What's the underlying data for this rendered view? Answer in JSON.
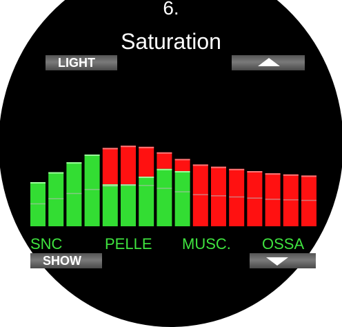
{
  "header": {
    "number": "6.",
    "title": "Saturation"
  },
  "softkeys": {
    "top_left": "LIGHT",
    "top_right_icon": "arrow-up-icon",
    "bottom_left": "SHOW",
    "bottom_right_icon": "arrow-down-icon"
  },
  "categories": {
    "snc": "SNC",
    "pelle": "PELLE",
    "musc": "MUSC.",
    "ossa": "OSSA"
  },
  "colors": {
    "green": "#33dd33",
    "red": "#ff1111",
    "background": "#000000",
    "text": "#ffffff",
    "label": "#3fe33f"
  },
  "chart_data": {
    "type": "bar",
    "description_units": "relative tissue saturation level per compartment (0-1)",
    "compartments": [
      {
        "total": 0.4,
        "green": 0.4
      },
      {
        "total": 0.49,
        "green": 0.49
      },
      {
        "total": 0.58,
        "green": 0.58
      },
      {
        "total": 0.65,
        "green": 0.65
      },
      {
        "total": 0.71,
        "green": 0.38
      },
      {
        "total": 0.73,
        "green": 0.38
      },
      {
        "total": 0.72,
        "green": 0.45
      },
      {
        "total": 0.67,
        "green": 0.52
      },
      {
        "total": 0.61,
        "green": 0.5
      },
      {
        "total": 0.56,
        "green": 0.0
      },
      {
        "total": 0.54,
        "green": 0.0
      },
      {
        "total": 0.52,
        "green": 0.0
      },
      {
        "total": 0.5,
        "green": 0.0
      },
      {
        "total": 0.48,
        "green": 0.0
      },
      {
        "total": 0.47,
        "green": 0.0
      },
      {
        "total": 0.46,
        "green": 0.0
      }
    ]
  }
}
